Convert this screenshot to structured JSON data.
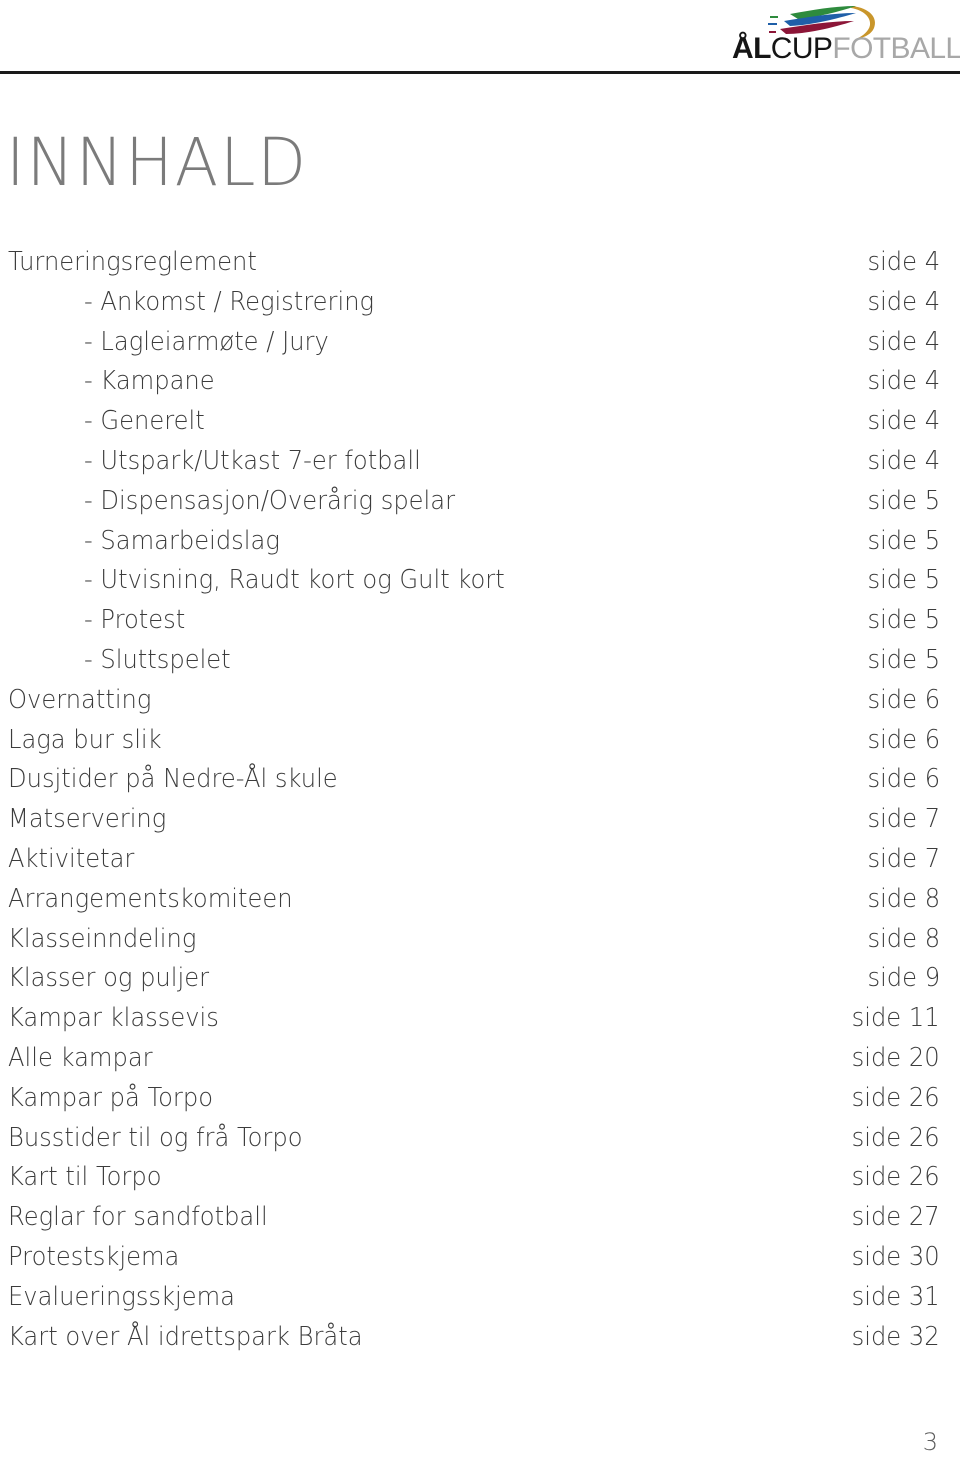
{
  "header": {
    "logo": {
      "part_bold": "ÅL",
      "part_mid": "CUP",
      "part_light": "FOTBALL",
      "swoosh_colors": [
        "#2e8b3d",
        "#1f5fa8",
        "#8c1638",
        "#c9962b"
      ]
    }
  },
  "title": "INNHALD",
  "toc": {
    "rows": [
      {
        "label": "Turneringsreglement",
        "page": "side 4",
        "sub": false
      },
      {
        "label": "- Ankomst / Registrering",
        "page": "side 4",
        "sub": true
      },
      {
        "label": "- Lagleiarmøte / Jury",
        "page": "side 4",
        "sub": true
      },
      {
        "label": "- Kampane",
        "page": "side 4",
        "sub": true
      },
      {
        "label": "- Generelt",
        "page": "side 4",
        "sub": true
      },
      {
        "label": "- Utspark/Utkast 7-er fotball",
        "page": "side 4",
        "sub": true
      },
      {
        "label": "- Dispensasjon/Overårig spelar",
        "page": "side 5",
        "sub": true
      },
      {
        "label": "- Samarbeidslag",
        "page": "side 5",
        "sub": true
      },
      {
        "label": "- Utvisning, Raudt kort og Gult kort",
        "page": "side 5",
        "sub": true
      },
      {
        "label": "- Protest",
        "page": "side 5",
        "sub": true
      },
      {
        "label": "- Sluttspelet",
        "page": "side 5",
        "sub": true
      },
      {
        "label": "Overnatting",
        "page": "side 6",
        "sub": false
      },
      {
        "label": "Laga bur slik",
        "page": "side 6",
        "sub": false
      },
      {
        "label": "Dusjtider på Nedre-Ål skule",
        "page": "side 6",
        "sub": false
      },
      {
        "label": "Matservering",
        "page": "side 7",
        "sub": false
      },
      {
        "label": "Aktivitetar",
        "page": "side 7",
        "sub": false
      },
      {
        "label": "Arrangementskomiteen",
        "page": "side 8",
        "sub": false
      },
      {
        "label": "Klasseinndeling",
        "page": "side 8",
        "sub": false
      },
      {
        "label": "Klasser og puljer",
        "page": "side 9",
        "sub": false
      },
      {
        "label": "Kampar klassevis",
        "page": "side 11",
        "sub": false
      },
      {
        "label": "Alle kampar",
        "page": "side 20",
        "sub": false
      },
      {
        "label": "Kampar på Torpo",
        "page": "side 26",
        "sub": false
      },
      {
        "label": "Busstider til og frå Torpo",
        "page": "side 26",
        "sub": false
      },
      {
        "label": "Kart til Torpo",
        "page": "side 26",
        "sub": false
      },
      {
        "label": "Reglar for sandfotball",
        "page": "side 27",
        "sub": false
      },
      {
        "label": "Protestskjema",
        "page": "side 30",
        "sub": false
      },
      {
        "label": "Evalueringsskjema",
        "page": "side 31",
        "sub": false
      },
      {
        "label": "Kart over Ål idrettspark Bråta",
        "page": "side 32",
        "sub": false
      }
    ]
  },
  "footer": {
    "folio": "3"
  }
}
